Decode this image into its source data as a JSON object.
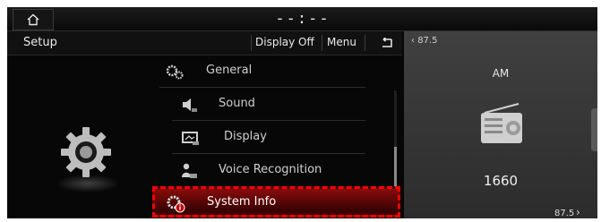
{
  "topbar": {
    "clock": "--:--"
  },
  "setup": {
    "title": "Setup",
    "display_off_label": "Display Off",
    "menu_label": "Menu",
    "items": [
      {
        "label": "General",
        "icon": "gear-icon"
      },
      {
        "label": "Sound",
        "icon": "speaker-icon"
      },
      {
        "label": "Display",
        "icon": "display-icon"
      },
      {
        "label": "Voice Recognition",
        "icon": "voice-icon"
      },
      {
        "label": "System Info",
        "icon": "system-info-icon",
        "selected": true
      }
    ]
  },
  "radio": {
    "prev_freq": "87.5",
    "band": "AM",
    "frequency": "1660",
    "next_freq": "87.5"
  },
  "colors": {
    "selection_red": "#8a0c0c",
    "highlight_dash": "#ff0000",
    "widget_bg": "#3a3a3a"
  }
}
